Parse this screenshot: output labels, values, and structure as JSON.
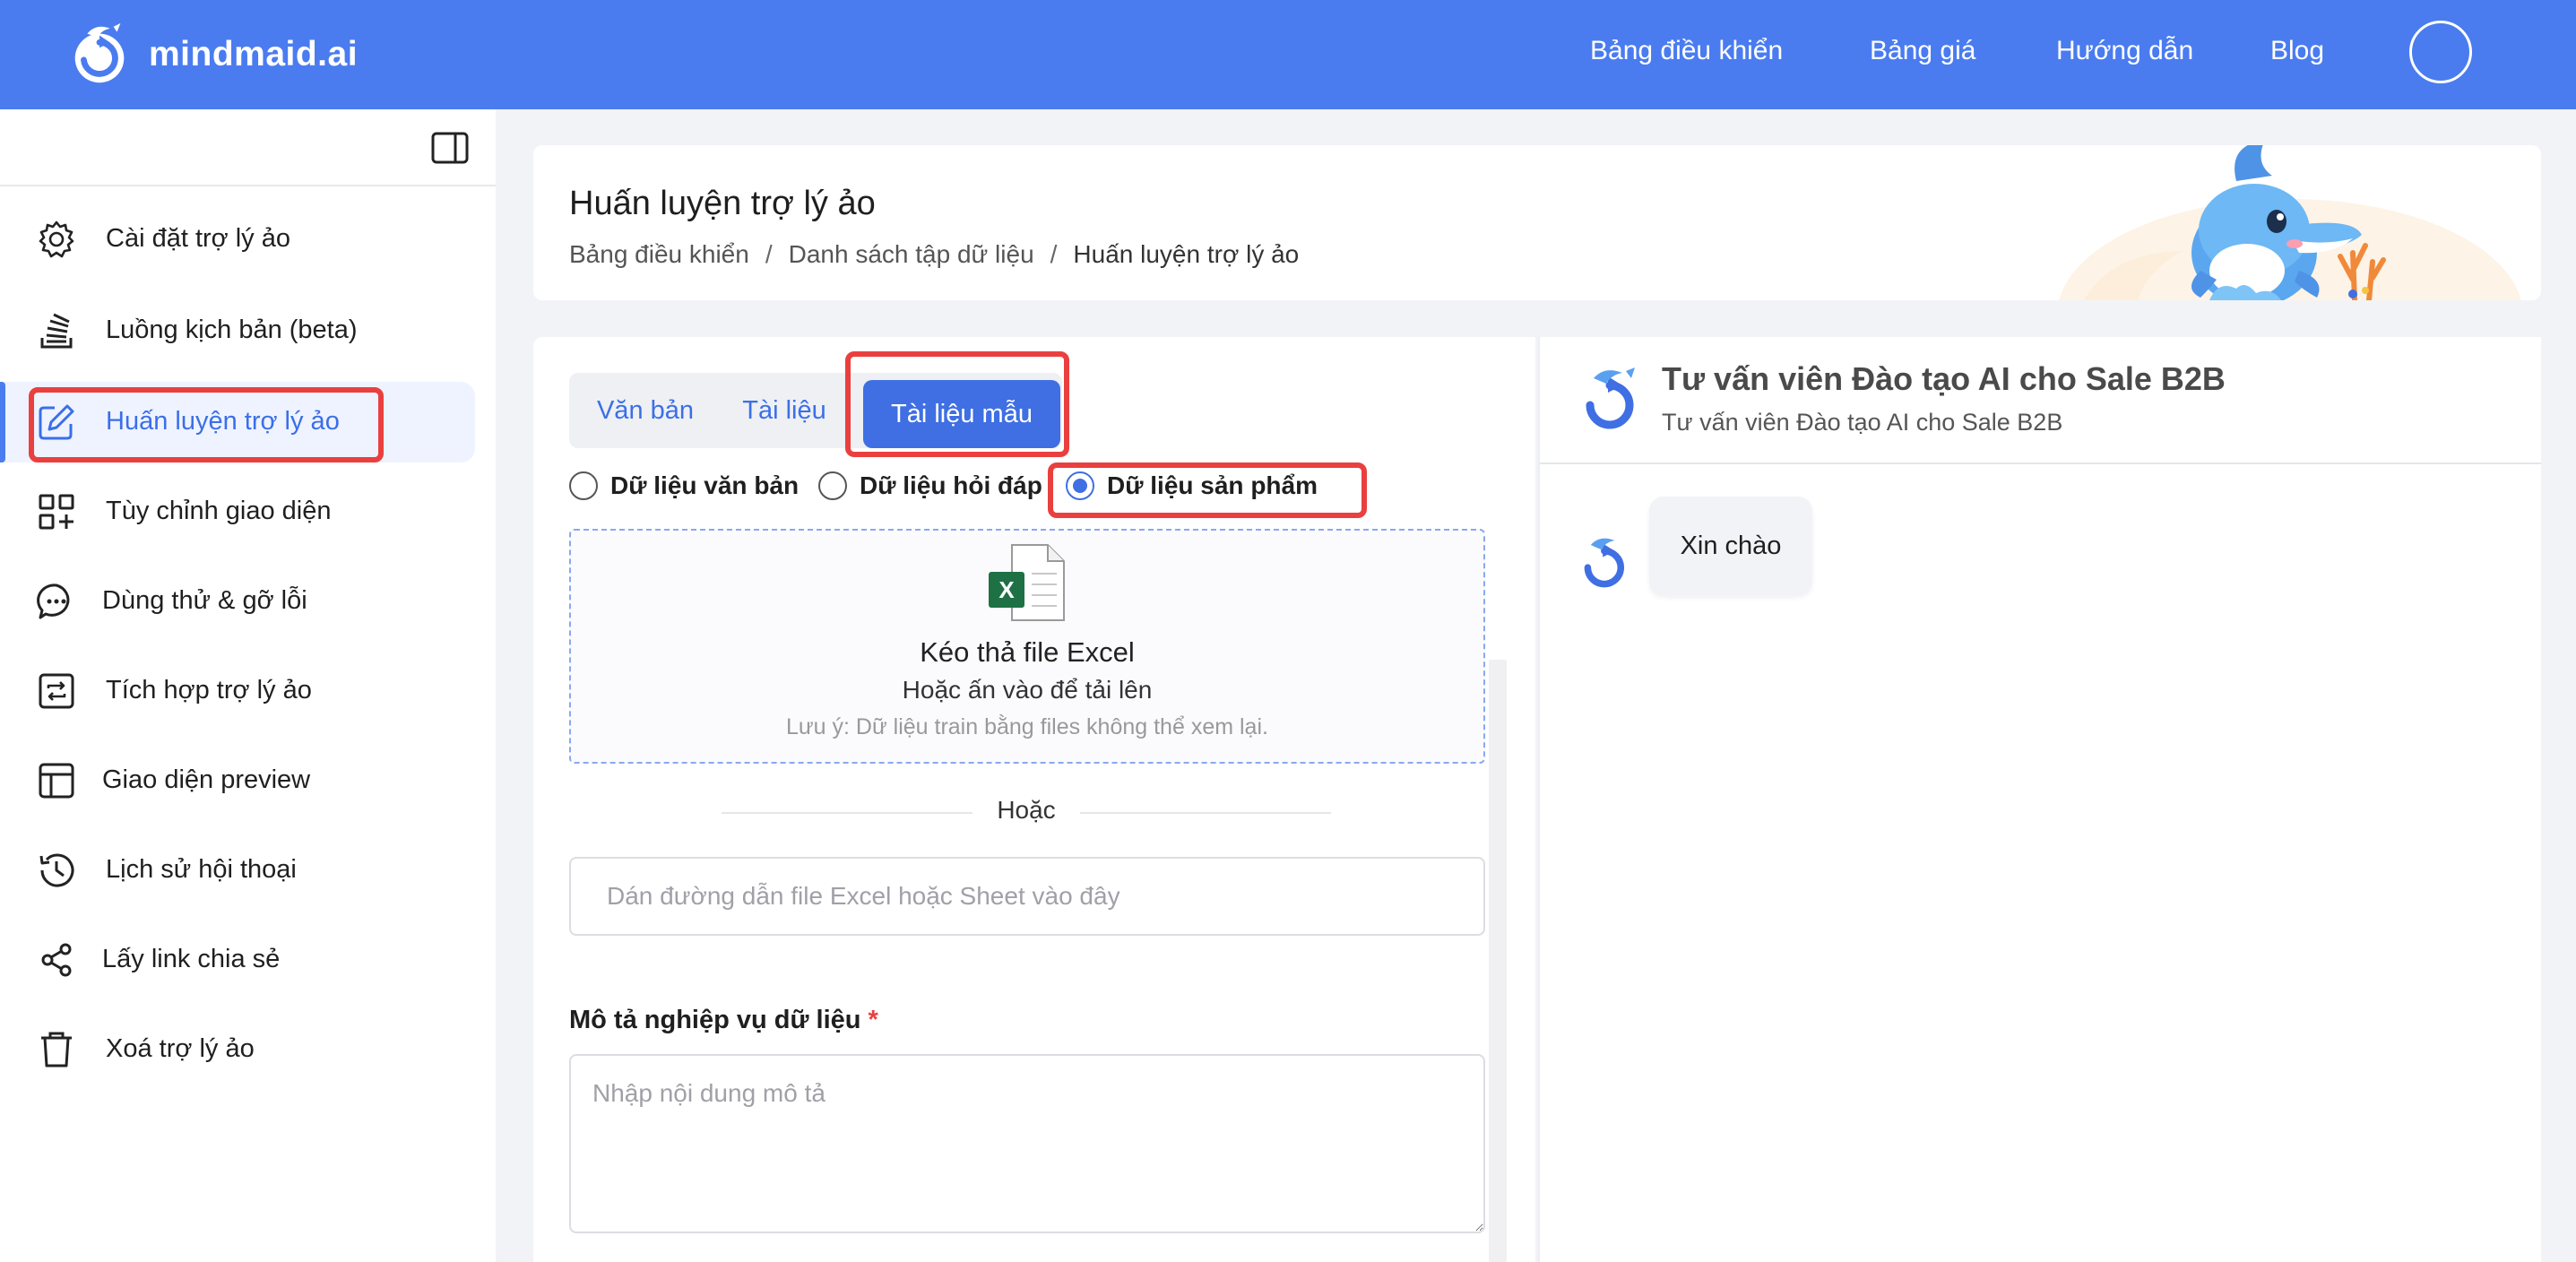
{
  "app": {
    "brand": "mindmaid.ai",
    "nav": [
      "Bảng điều khiển",
      "Bảng giá",
      "Hướng dẫn",
      "Blog"
    ]
  },
  "sidebar": {
    "items": [
      {
        "label": "Cài đặt trợ lý ảo",
        "icon": "gear-icon"
      },
      {
        "label": "Luồng kịch bản (beta)",
        "icon": "stack-icon"
      },
      {
        "label": "Huấn luyện trợ lý ảo",
        "icon": "edit-icon",
        "active": true
      },
      {
        "label": "Tùy chỉnh giao diện",
        "icon": "grid-plus-icon"
      },
      {
        "label": "Dùng thử & gỡ lỗi",
        "icon": "chat-icon"
      },
      {
        "label": "Tích hợp trợ lý ảo",
        "icon": "sync-icon"
      },
      {
        "label": "Giao diện preview",
        "icon": "layout-icon"
      },
      {
        "label": "Lịch sử hội thoại",
        "icon": "history-icon"
      },
      {
        "label": "Lấy link chia sẻ",
        "icon": "share-icon"
      },
      {
        "label": "Xoá trợ lý ảo",
        "icon": "trash-icon"
      }
    ]
  },
  "header": {
    "title": "Huấn luyện trợ lý ảo",
    "breadcrumb": [
      "Bảng điều khiển",
      "Danh sách tập dữ liệu",
      "Huấn luyện trợ lý ảo"
    ],
    "separator": "/"
  },
  "training": {
    "tabs": [
      "Văn bản",
      "Tài liệu",
      "Tài liệu mẫu"
    ],
    "active_tab": "Tài liệu mẫu",
    "radios": [
      "Dữ liệu văn bản",
      "Dữ liệu hỏi đáp",
      "Dữ liệu sản phẩm"
    ],
    "selected_radio": "Dữ liệu sản phẩm",
    "dropzone": {
      "title": "Kéo thả file Excel",
      "subtitle": "Hoặc ấn vào để tải lên",
      "note": "Lưu ý: Dữ liệu train bằng files không thể xem lại."
    },
    "or_text": "Hoặc",
    "url_placeholder": "Dán đường dẫn file Excel hoặc Sheet vào đây",
    "description_label": "Mô tả nghiệp vụ dữ liệu",
    "required_mark": "*",
    "description_placeholder": "Nhập nội dung mô tả"
  },
  "chat": {
    "bot_name": "Tư vấn viên Đào tạo AI cho Sale B2B",
    "bot_subtitle": "Tư vấn viên Đào tạo AI cho Sale B2B",
    "messages": [
      {
        "from": "bot",
        "text": "Xin chào"
      }
    ]
  },
  "colors": {
    "brand": "#4a7cf0",
    "active_tab": "#3f6fe3",
    "highlight": "#e9403f",
    "excel_green": "#1e7145"
  }
}
